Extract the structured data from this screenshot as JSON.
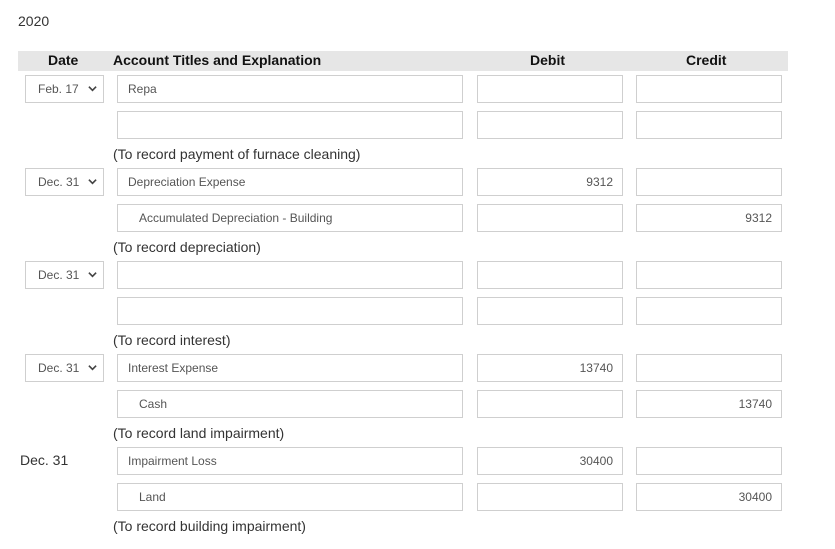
{
  "year": "2020",
  "header": {
    "date": "Date",
    "account": "Account Titles and Explanation",
    "debit": "Debit",
    "credit": "Credit"
  },
  "entries": [
    {
      "date": "Feb. 17",
      "date_type": "select",
      "lines": [
        {
          "account": "Repa",
          "debit": "",
          "credit": ""
        },
        {
          "account": "",
          "debit": "",
          "credit": ""
        }
      ],
      "explanation": "(To record payment of furnace cleaning)"
    },
    {
      "date": "Dec. 31",
      "date_type": "select",
      "lines": [
        {
          "account": "Depreciation Expense",
          "debit": "9312",
          "credit": ""
        },
        {
          "account": "Accumulated Depreciation - Building",
          "debit": "",
          "credit": "9312"
        }
      ],
      "explanation": "(To record depreciation)"
    },
    {
      "date": "Dec. 31",
      "date_type": "select",
      "lines": [
        {
          "account": "",
          "debit": "",
          "credit": ""
        },
        {
          "account": "",
          "debit": "",
          "credit": ""
        }
      ],
      "explanation": "(To record interest)"
    },
    {
      "date": "Dec. 31",
      "date_type": "select",
      "lines": [
        {
          "account": "Interest Expense",
          "debit": "13740",
          "credit": ""
        },
        {
          "account": "Cash",
          "debit": "",
          "credit": "13740"
        }
      ],
      "explanation": "(To record land impairment)"
    },
    {
      "date": "Dec. 31",
      "date_type": "static",
      "lines": [
        {
          "account": "Impairment Loss",
          "debit": "30400",
          "credit": ""
        },
        {
          "account": "Land",
          "debit": "",
          "credit": "30400"
        }
      ],
      "explanation": "(To record building impairment)"
    }
  ]
}
